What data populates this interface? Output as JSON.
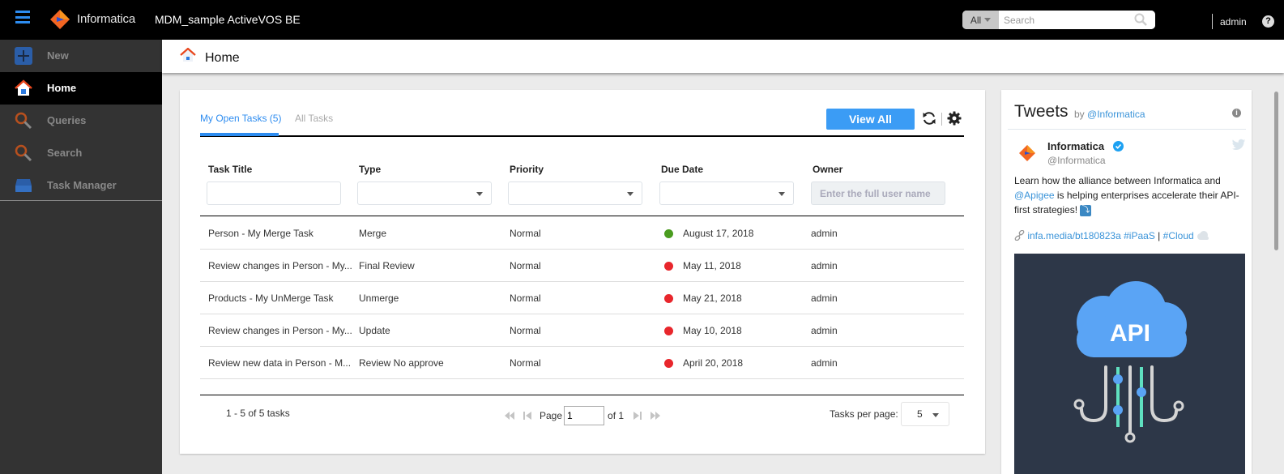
{
  "topbar": {
    "brand": "Informatica",
    "app_title": "MDM_sample ActiveVOS BE",
    "search_scope": "All",
    "search_placeholder": "Search",
    "user": "admin",
    "help_glyph": "?"
  },
  "sidebar": {
    "items": [
      {
        "label": "New",
        "icon": "plus-icon"
      },
      {
        "label": "Home",
        "icon": "home-icon",
        "active": true
      },
      {
        "label": "Queries",
        "icon": "search-icon"
      },
      {
        "label": "Search",
        "icon": "search-icon"
      },
      {
        "label": "Task Manager",
        "icon": "inbox-icon"
      }
    ]
  },
  "page": {
    "title": "Home"
  },
  "tasks": {
    "tabs": [
      {
        "label": "My Open Tasks (5)",
        "active": true
      },
      {
        "label": "All Tasks",
        "active": false
      }
    ],
    "view_all_label": "View All",
    "columns": [
      "Task Title",
      "Type",
      "Priority",
      "Due Date",
      "Owner"
    ],
    "owner_placeholder": "Enter the full user name",
    "rows": [
      {
        "title": "Person - My Merge Task",
        "type": "Merge",
        "priority": "Normal",
        "due": "August 17, 2018",
        "status": "on-time",
        "status_color": "#4a9c1f",
        "owner": "admin"
      },
      {
        "title": "Review changes in Person - My...",
        "type": "Final Review",
        "priority": "Normal",
        "due": "May 11, 2018",
        "status": "overdue",
        "status_color": "#e8262c",
        "owner": "admin"
      },
      {
        "title": "Products - My UnMerge Task",
        "type": "Unmerge",
        "priority": "Normal",
        "due": "May 21, 2018",
        "status": "overdue",
        "status_color": "#e8262c",
        "owner": "admin"
      },
      {
        "title": "Review changes in Person - My...",
        "type": "Update",
        "priority": "Normal",
        "due": "May 10, 2018",
        "status": "overdue",
        "status_color": "#e8262c",
        "owner": "admin"
      },
      {
        "title": "Review new data in Person - M...",
        "type": "Review No approve",
        "priority": "Normal",
        "due": "April 20, 2018",
        "status": "overdue",
        "status_color": "#e8262c",
        "owner": "admin"
      }
    ],
    "count_text": "1 - 5 of 5 tasks",
    "pager": {
      "page_label": "Page",
      "page_value": "1",
      "of_label": "of 1"
    },
    "per_page_label": "Tasks per page:",
    "per_page_value": "5"
  },
  "tweets": {
    "title": "Tweets",
    "by_prefix": "by",
    "by_handle": "@Informatica",
    "tweet": {
      "name": "Informatica",
      "handle": "@Informatica",
      "text_before": "Learn how the alliance between Informatica and ",
      "mention": "@Apigee",
      "text_after": " is helping enterprises accelerate their API-first strategies! ",
      "emoji": "⤵",
      "link": "infa.media/bt180823a",
      "hashtag1": "#iPaaS",
      "separator": "|",
      "hashtag2": "#Cloud",
      "image_text": "API"
    }
  },
  "colors": {
    "accent": "#2d8cf0",
    "button": "#3b9cf5",
    "brand_orange": "#f26522",
    "overdue": "#e8262c",
    "on_time": "#4a9c1f"
  }
}
